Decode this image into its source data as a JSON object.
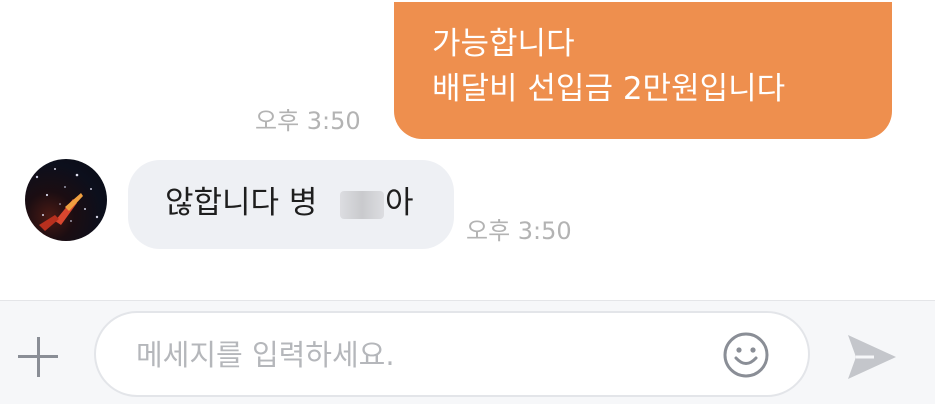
{
  "messages": {
    "outgoing": {
      "lines": [
        "가능합니다",
        "배달비 선입금 2만원입니다"
      ],
      "time": "오후 3:50"
    },
    "incoming": {
      "text_before": "않합니다 병",
      "text_after": "아",
      "time": "오후 3:50",
      "avatar_icon": "profile-avatar"
    }
  },
  "composer": {
    "placeholder": "메세지를 입력하세요.",
    "value": "",
    "attach_icon": "plus-icon",
    "emoji_icon": "smiley-icon",
    "send_icon": "send-icon"
  },
  "colors": {
    "outgoing_bubble": "#ee8f4e",
    "incoming_bubble": "#eef0f4",
    "timestamp": "#b3b3b3",
    "icon": "#8a8e96"
  }
}
